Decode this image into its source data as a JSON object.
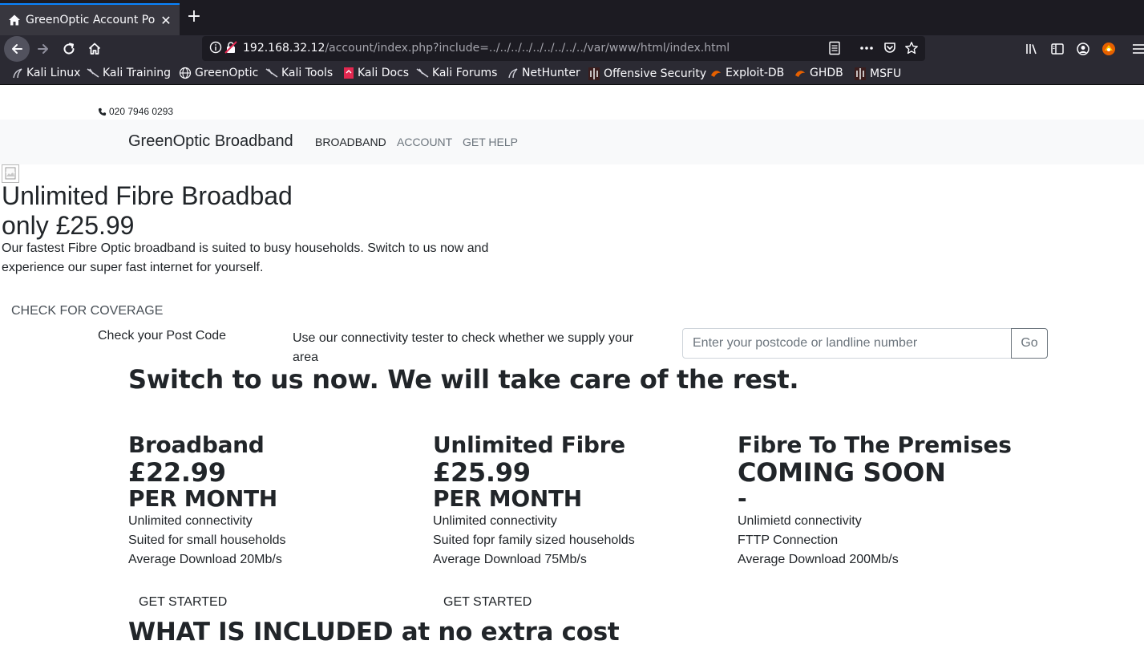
{
  "browser": {
    "tab_title": "GreenOptic Account Port",
    "url_host": "192.168.32.12",
    "url_path": "/account/index.php?include=../../../../../../../../../var/www/html/index.html",
    "bookmarks": [
      {
        "label": "Kali Linux",
        "icon": "kali-dragon-icon"
      },
      {
        "label": "Kali Training",
        "icon": "kali-dragon-icon"
      },
      {
        "label": "GreenOptic",
        "icon": "globe-icon"
      },
      {
        "label": "Kali Tools",
        "icon": "kali-dragon-icon"
      },
      {
        "label": "Kali Docs",
        "icon": "kali-docs-icon"
      },
      {
        "label": "Kali Forums",
        "icon": "kali-dragon-icon"
      },
      {
        "label": "NetHunter",
        "icon": "kali-dragon-icon"
      },
      {
        "label": "Offensive Security",
        "icon": "offsec-icon"
      },
      {
        "label": "Exploit-DB",
        "icon": "exploitdb-icon"
      },
      {
        "label": "GHDB",
        "icon": "exploitdb-icon"
      },
      {
        "label": "MSFU",
        "icon": "offsec-icon"
      }
    ]
  },
  "site": {
    "phone": "020 7946 0293",
    "brand": "GreenOptic Broadband",
    "nav": {
      "broadband": "BROADBAND",
      "account": "ACCOUNT",
      "help": "GET HELP"
    },
    "hero": {
      "title": "Unlimited Fibre Broadbad",
      "price": "only £25.99",
      "description": "Our fastest Fibre Optic broadband is suited to busy households. Switch to us now and experience our super fast internet for yourself."
    },
    "coverage": {
      "link": "CHECK FOR COVERAGE",
      "title": "Check your Post Code",
      "description": "Use our connectivity tester to check whether we supply your area",
      "input_placeholder": "Enter your postcode or landline number",
      "button": "Go"
    },
    "switch_heading": "Switch to us now. We will take care of the rest.",
    "plans": [
      {
        "name": "Broadband",
        "price": "£22.99",
        "period": "PER MONTH",
        "features": [
          "Unlimited connectivity",
          "Suited for small households",
          "Average Download 20Mb/s"
        ],
        "cta": "GET STARTED"
      },
      {
        "name": "Unlimited Fibre",
        "price": "£25.99",
        "period": "PER MONTH",
        "features": [
          "Unlimited connectivity",
          "Suited fopr family sized households",
          "Average Download 75Mb/s"
        ],
        "cta": "GET STARTED"
      },
      {
        "name": "Fibre To The Premises",
        "price": "COMING SOON",
        "period": "-",
        "features": [
          "Unlimietd connectivity",
          "FTTP Connection",
          "Average Download 200Mb/s"
        ],
        "cta": ""
      }
    ],
    "included_heading": "WHAT IS INCLUDED at no extra cost"
  }
}
